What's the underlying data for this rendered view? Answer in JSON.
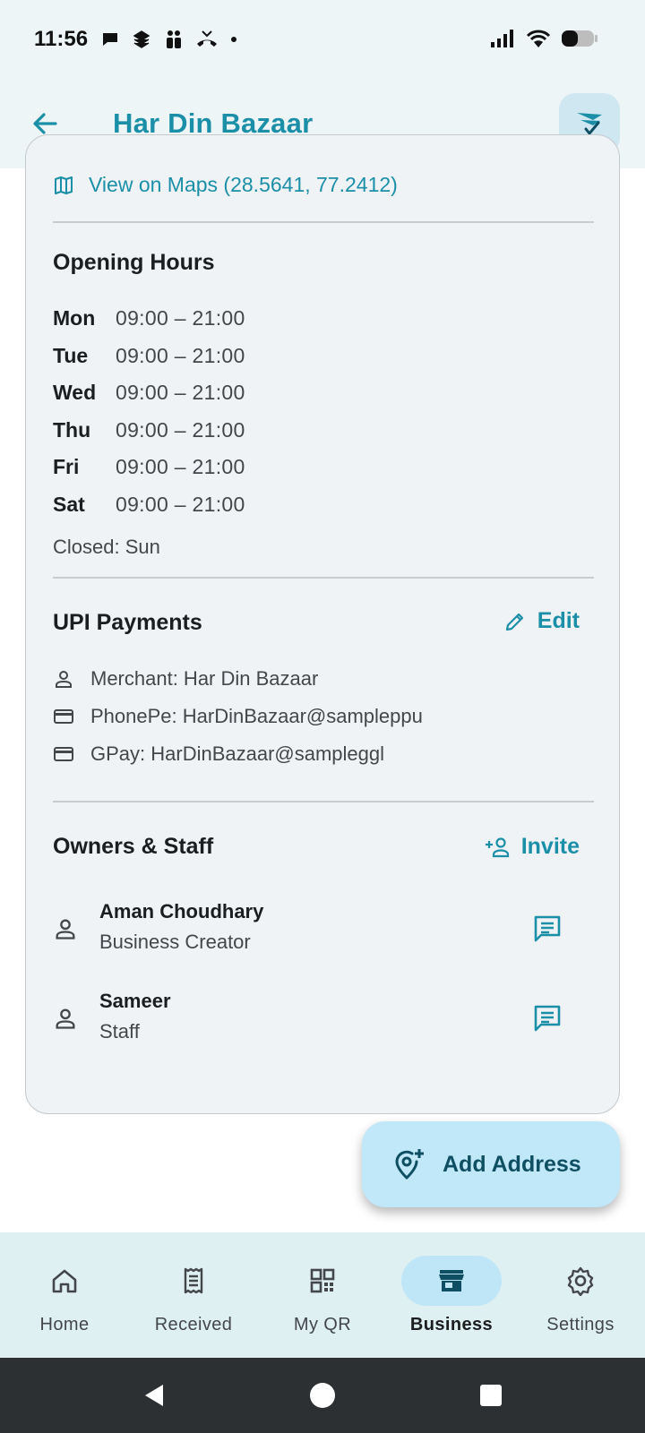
{
  "status_bar": {
    "time": "11:56"
  },
  "app_bar": {
    "title": "Har Din Bazaar"
  },
  "location": {
    "maps_link": "View on Maps (28.5641, 77.2412)"
  },
  "opening_hours": {
    "title": "Opening Hours",
    "days": [
      {
        "day": "Mon",
        "time": "09:00 – 21:00"
      },
      {
        "day": "Tue",
        "time": "09:00 – 21:00"
      },
      {
        "day": "Wed",
        "time": "09:00 – 21:00"
      },
      {
        "day": "Thu",
        "time": "09:00 – 21:00"
      },
      {
        "day": "Fri",
        "time": "09:00 – 21:00"
      },
      {
        "day": "Sat",
        "time": "09:00 – 21:00"
      }
    ],
    "closed": "Closed: Sun"
  },
  "upi": {
    "title": "UPI Payments",
    "edit_label": "Edit",
    "merchant": "Merchant: Har Din Bazaar",
    "phonepe": "PhonePe: HarDinBazaar@sampleppu",
    "gpay": "GPay: HarDinBazaar@sampleggl"
  },
  "staff": {
    "title": "Owners & Staff",
    "invite_label": "Invite",
    "people": [
      {
        "name": "Aman Choudhary",
        "role": "Business Creator"
      },
      {
        "name": "Sameer",
        "role": "Staff"
      }
    ]
  },
  "fab": {
    "label": "Add Address"
  },
  "bottom_nav": {
    "items": [
      {
        "label": "Home",
        "icon": "home-icon"
      },
      {
        "label": "Received",
        "icon": "receipt-icon"
      },
      {
        "label": "My QR",
        "icon": "qr-code-icon"
      },
      {
        "label": "Business",
        "icon": "store-icon",
        "active": true
      },
      {
        "label": "Settings",
        "icon": "gear-icon"
      }
    ]
  },
  "colors": {
    "accent": "#1b8fa8",
    "card_bg": "#eff3f6",
    "active_pill": "#bfe6f7",
    "fab_bg": "#c0e8f9"
  }
}
